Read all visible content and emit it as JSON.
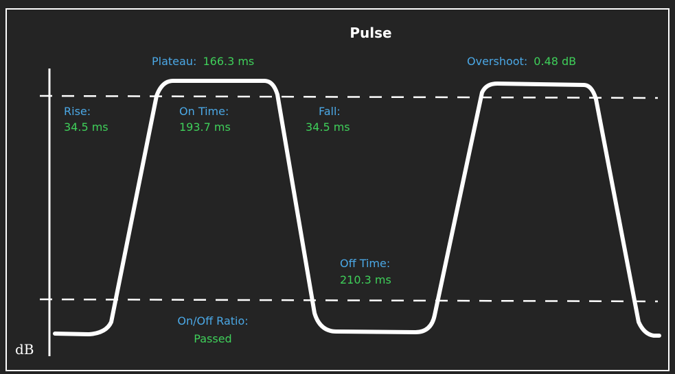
{
  "chart_data": {
    "type": "line",
    "title": "Pulse",
    "ylabel": "dB",
    "measurements": {
      "plateau": {
        "label": "Plateau:",
        "value": "166.3 ms"
      },
      "overshoot": {
        "label": "Overshoot:",
        "value": "0.48 dB"
      },
      "rise": {
        "label": "Rise:",
        "value": "34.5 ms"
      },
      "on_time": {
        "label": "On Time:",
        "value": "193.7 ms"
      },
      "fall": {
        "label": "Fall:",
        "value": "34.5 ms"
      },
      "off_time": {
        "label": "Off Time:",
        "value": "210.3 ms"
      },
      "on_off_ratio": {
        "label": "On/Off Ratio:",
        "value": "Passed"
      }
    },
    "threshold_lines": [
      "upper",
      "lower"
    ],
    "colors": {
      "background": "#242424",
      "frame": "#ffffff",
      "trace": "#ffffff",
      "label": "#4ba8e6",
      "value": "#3fd05a"
    }
  }
}
